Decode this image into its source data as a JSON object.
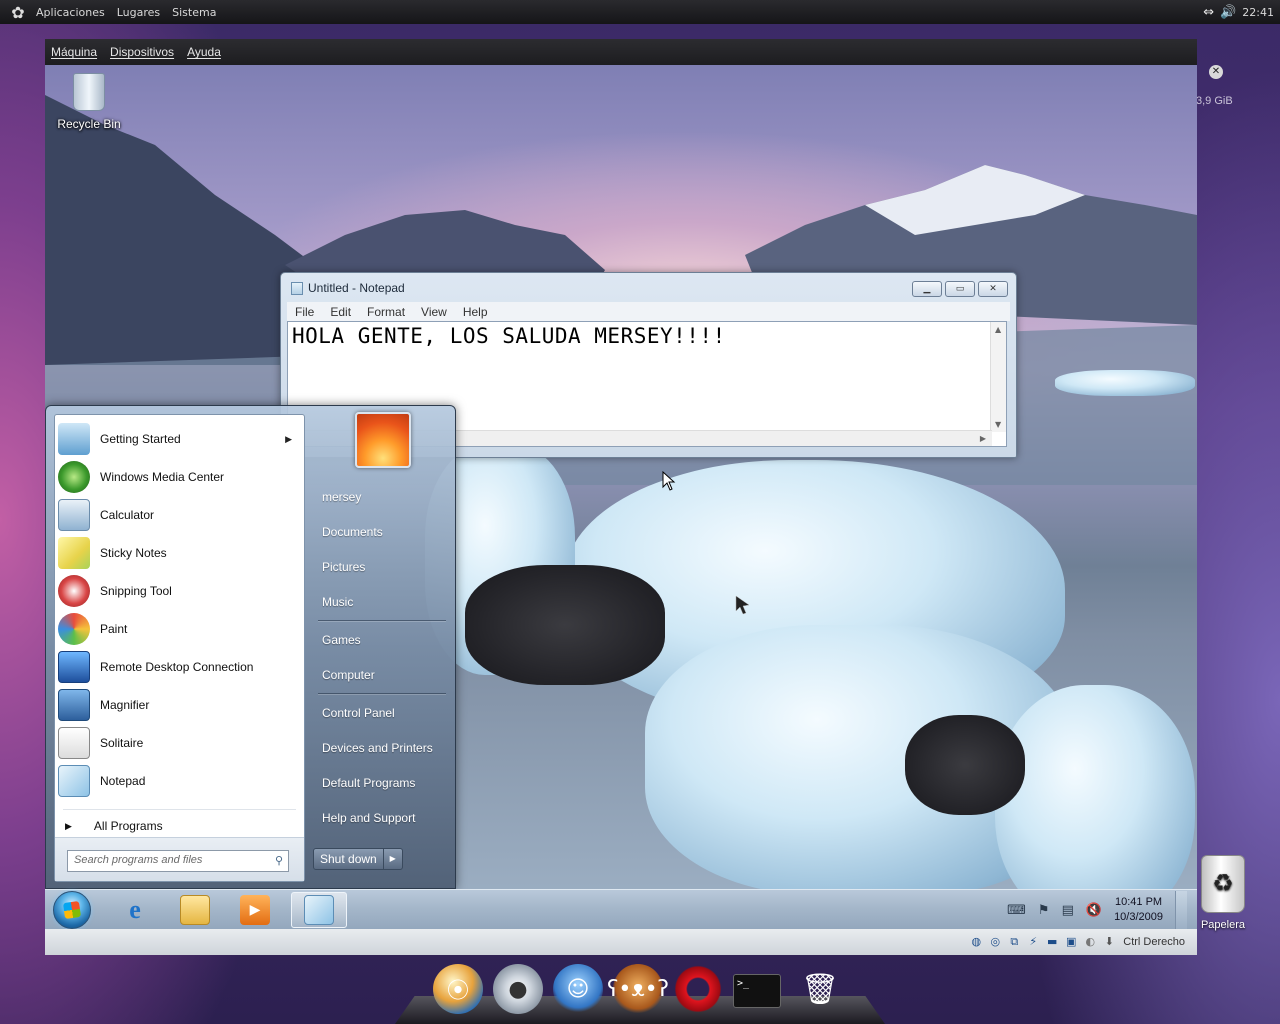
{
  "host_panel": {
    "menus": [
      "Aplicaciones",
      "Lugares",
      "Sistema"
    ],
    "time": "22:41",
    "disk_label": "3,9 GiB",
    "trash_label": "Papelera"
  },
  "vbox": {
    "menus": [
      "Máquina",
      "Dispositivos",
      "Ayuda"
    ],
    "host_key": "Ctrl Derecho"
  },
  "guest": {
    "recycle_bin_label": "Recycle Bin",
    "notepad": {
      "title": "Untitled - Notepad",
      "menus": [
        "File",
        "Edit",
        "Format",
        "View",
        "Help"
      ],
      "content": "HOLA GENTE, LOS SALUDA MERSEY!!!!"
    },
    "start_menu": {
      "programs": [
        {
          "label": "Getting Started",
          "icon": "getting-started-icon",
          "has_submenu": true
        },
        {
          "label": "Windows Media Center",
          "icon": "media-center-icon"
        },
        {
          "label": "Calculator",
          "icon": "calculator-icon"
        },
        {
          "label": "Sticky Notes",
          "icon": "sticky-notes-icon"
        },
        {
          "label": "Snipping Tool",
          "icon": "snipping-tool-icon"
        },
        {
          "label": "Paint",
          "icon": "paint-icon"
        },
        {
          "label": "Remote Desktop Connection",
          "icon": "remote-desktop-icon"
        },
        {
          "label": "Magnifier",
          "icon": "magnifier-icon"
        },
        {
          "label": "Solitaire",
          "icon": "solitaire-icon"
        },
        {
          "label": "Notepad",
          "icon": "notepad-icon"
        }
      ],
      "all_programs": "All Programs",
      "search_placeholder": "Search programs and files",
      "places": [
        "mersey",
        "Documents",
        "Pictures",
        "Music",
        "Games",
        "Computer",
        "Control Panel",
        "Devices and Printers",
        "Default Programs",
        "Help and Support"
      ],
      "shutdown_label": "Shut down"
    },
    "taskbar": {
      "time": "10:41 PM",
      "date": "10/3/2009"
    }
  },
  "colors": {
    "taskbar": "#a5b7ca",
    "start_menu_glass": "#8096b0",
    "host_panel": "#1f1f22"
  }
}
